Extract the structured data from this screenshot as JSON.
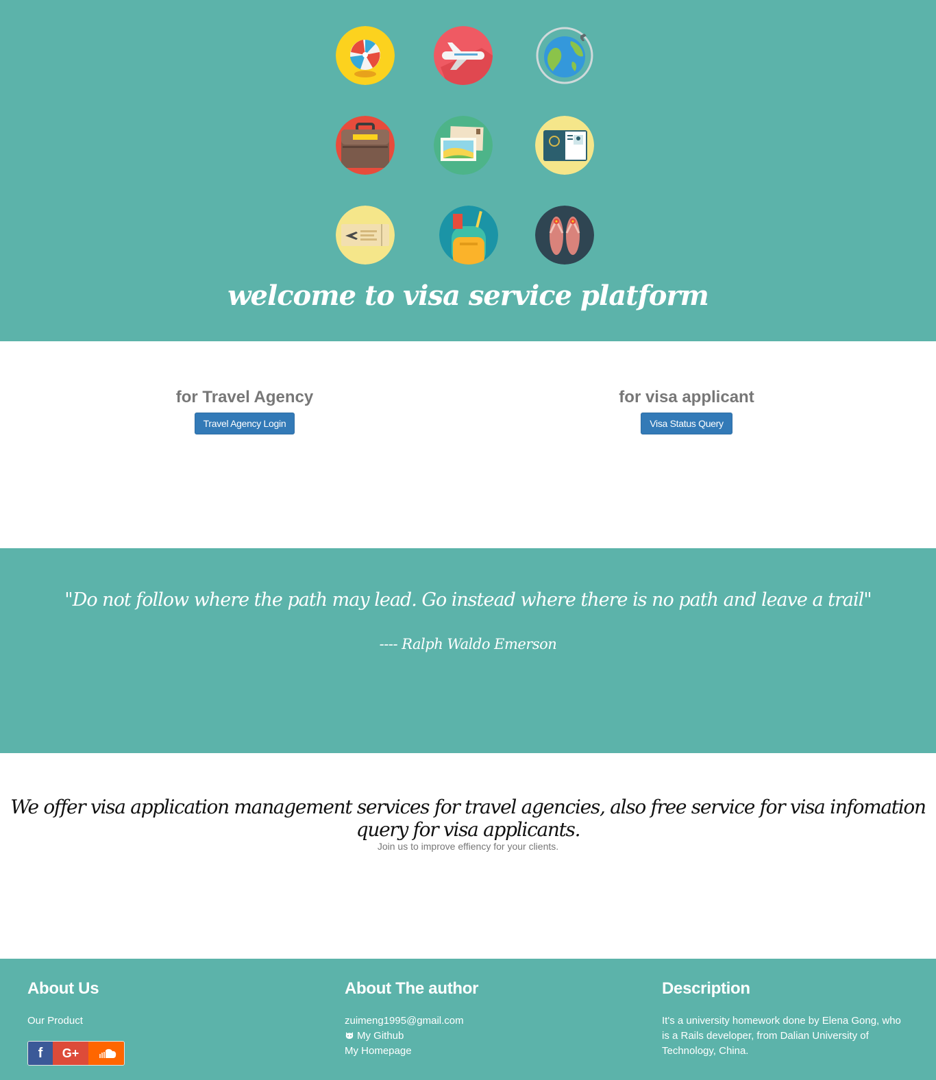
{
  "hero": {
    "title": "welcome to visa service platform",
    "icons": [
      "beach-ball-icon",
      "airplane-icon",
      "globe-icon",
      "suitcase-icon",
      "postcard-icon",
      "passport-icon",
      "boarding-pass-icon",
      "backpack-icon",
      "flip-flops-icon"
    ]
  },
  "cta": {
    "agency": {
      "heading": "for Travel Agency",
      "button": "Travel Agency Login"
    },
    "applicant": {
      "heading": "for visa applicant",
      "button": "Visa Status Query"
    }
  },
  "quote": {
    "text": "\"Do not follow where the path may lead. Go instead where there is no path and leave a trail\"",
    "author": "---- Ralph Waldo Emerson"
  },
  "about": {
    "main": "We offer visa application management services for travel agencies, also free service for visa infomation query for visa applicants.",
    "sub": "Join us to improve effiency for your clients."
  },
  "footer": {
    "about_us": {
      "heading": "About Us",
      "link": "Our Product"
    },
    "author": {
      "heading": "About The author",
      "email": "zuimeng1995@gmail.com",
      "github": "My Github",
      "homepage": "My Homepage"
    },
    "description": {
      "heading": "Description",
      "text": "It's a university homework done by Elena Gong, who is a Rails developer, from Dalian University of Technology, China."
    },
    "social": {
      "facebook": "f",
      "google_plus": "G+"
    }
  },
  "colors": {
    "teal": "#5cb3aa",
    "button": "#337ab7",
    "facebook": "#3b5998",
    "google_plus": "#dd4b39",
    "soundcloud": "#ff6600"
  }
}
